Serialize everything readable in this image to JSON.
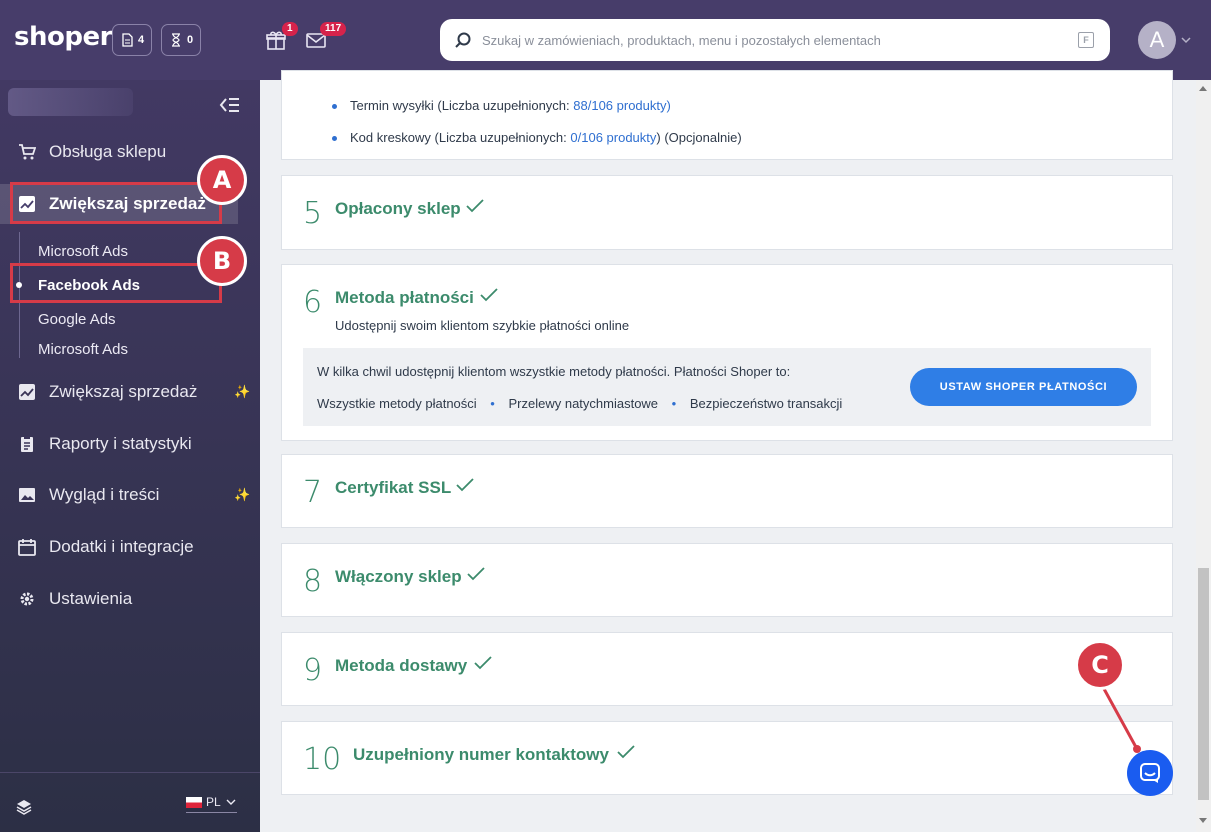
{
  "topbar": {
    "logo": "shoper",
    "docs_count": "4",
    "hourglass_count": "0",
    "gift_badge": "1",
    "mail_badge": "117",
    "search_placeholder": "Szukaj w zamówieniach, produktach, menu i pozostałych elementach",
    "search_shortcut": "F",
    "avatar_letter": "A"
  },
  "sidebar": {
    "items": [
      {
        "label": "Obsługa sklepu",
        "icon": "cart-icon"
      },
      {
        "label": "Zwiększaj sprzedaż",
        "icon": "chart-icon"
      },
      {
        "label": "Zwiększaj sprzedaż",
        "icon": "chart-icon"
      },
      {
        "label": "Raporty i statystyki",
        "icon": "clipboard-icon"
      },
      {
        "label": "Wygląd i treści",
        "icon": "image-icon"
      },
      {
        "label": "Dodatki i integracje",
        "icon": "calendar-icon"
      },
      {
        "label": "Ustawienia",
        "icon": "gear-icon"
      }
    ],
    "subitems": [
      "Microsoft Ads",
      "Facebook Ads",
      "Google Ads",
      "Microsoft Ads"
    ],
    "language": "PL"
  },
  "annotations": {
    "a": "A",
    "b": "B",
    "c": "C",
    "color": "#d63b48"
  },
  "main": {
    "partial_card": {
      "line1_prefix": "Termin wysyłki (Liczba uzupełnionych: ",
      "line1_link": "88/106 produkty)",
      "line2_prefix": "Kod kreskowy (Liczba uzupełnionych: ",
      "line2_link": "0/106 produkty",
      "line2_suffix": ") (Opcjonalnie)"
    },
    "steps": [
      {
        "num": "5",
        "title": "Opłacony sklep"
      },
      {
        "num": "6",
        "title": "Metoda płatności",
        "subtitle": "Udostępnij swoim klientom szybkie płatności online"
      },
      {
        "num": "7",
        "title": "Certyfikat SSL"
      },
      {
        "num": "8",
        "title": "Włączony sklep"
      },
      {
        "num": "9",
        "title": "Metoda dostawy"
      },
      {
        "num": "10",
        "title": "Uzupełniony numer kontaktowy"
      }
    ],
    "payment_note": {
      "intro": "W kilka chwil udostępnij klientom wszystkie metody płatności. Płatności Shoper to:",
      "features": [
        "Wszystkie metody płatności",
        "Przelewy natychmiastowe",
        "Bezpieczeństwo transakcji"
      ],
      "button": "USTAW SHOPER PŁATNOŚCI"
    }
  },
  "colors": {
    "accent_green": "#3c8b6c",
    "topbar": "#473d6a",
    "button_blue": "#2f7ee6",
    "chat_blue": "#1a5cf0"
  }
}
